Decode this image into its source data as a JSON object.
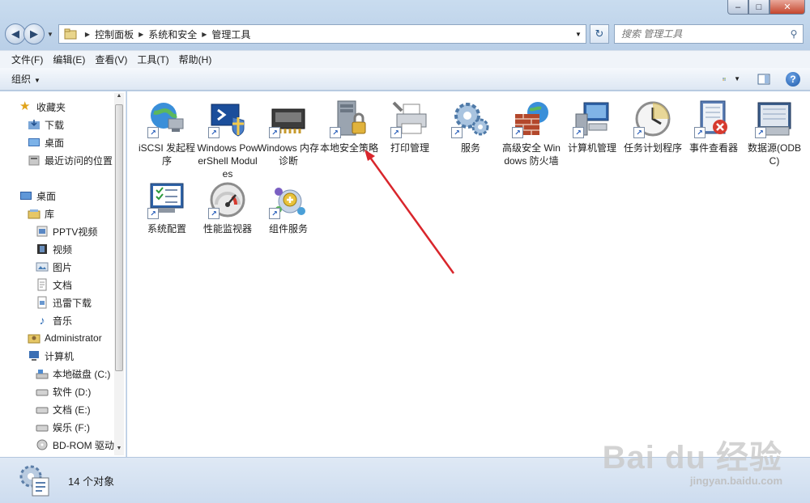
{
  "window": {
    "minimize": "–",
    "maximize": "□",
    "close": "✕"
  },
  "nav": {
    "back_icon": "back-arrow",
    "forward_icon": "forward-arrow",
    "breadcrumb": [
      "控制面板",
      "系统和安全",
      "管理工具"
    ],
    "refresh": "↻",
    "search_placeholder": "搜索 管理工具"
  },
  "menubar": [
    "文件(F)",
    "编辑(E)",
    "查看(V)",
    "工具(T)",
    "帮助(H)"
  ],
  "toolbar": {
    "organize": "组织",
    "help": "?"
  },
  "sidebar": {
    "favorites": {
      "label": "收藏夹",
      "items": [
        "下载",
        "桌面",
        "最近访问的位置"
      ]
    },
    "desktop": "桌面",
    "library": {
      "label": "库",
      "items": [
        "PPTV视频",
        "视频",
        "图片",
        "文档",
        "迅雷下载",
        "音乐"
      ]
    },
    "user": "Administrator",
    "computer": {
      "label": "计算机",
      "items": [
        "本地磁盘 (C:)",
        "软件 (D:)",
        "文档 (E:)",
        "娱乐 (F:)",
        "BD-ROM 驱动"
      ]
    }
  },
  "items": [
    {
      "label": "iSCSI 发起程序",
      "icon": "globe-network-icon"
    },
    {
      "label": "Windows PowerShell Modules",
      "icon": "powershell-icon"
    },
    {
      "label": "Windows 内存诊断",
      "icon": "memory-chip-icon"
    },
    {
      "label": "本地安全策略",
      "icon": "server-lock-icon"
    },
    {
      "label": "打印管理",
      "icon": "printer-icon"
    },
    {
      "label": "服务",
      "icon": "gears-icon"
    },
    {
      "label": "高级安全 Windows 防火墙",
      "icon": "firewall-icon"
    },
    {
      "label": "计算机管理",
      "icon": "computer-management-icon"
    },
    {
      "label": "任务计划程序",
      "icon": "clock-icon"
    },
    {
      "label": "事件查看器",
      "icon": "event-viewer-icon"
    },
    {
      "label": "数据源(ODBC)",
      "icon": "database-icon"
    },
    {
      "label": "系统配置",
      "icon": "system-config-icon"
    },
    {
      "label": "性能监视器",
      "icon": "gauge-icon"
    },
    {
      "label": "组件服务",
      "icon": "component-services-icon"
    }
  ],
  "status": {
    "count": "14 个对象"
  },
  "watermark": {
    "main": "Bai du 经验",
    "sub": "jingyan.baidu.com"
  },
  "colors": {
    "annotation_arrow": "#d9262c",
    "chrome": "#c9dcef"
  }
}
